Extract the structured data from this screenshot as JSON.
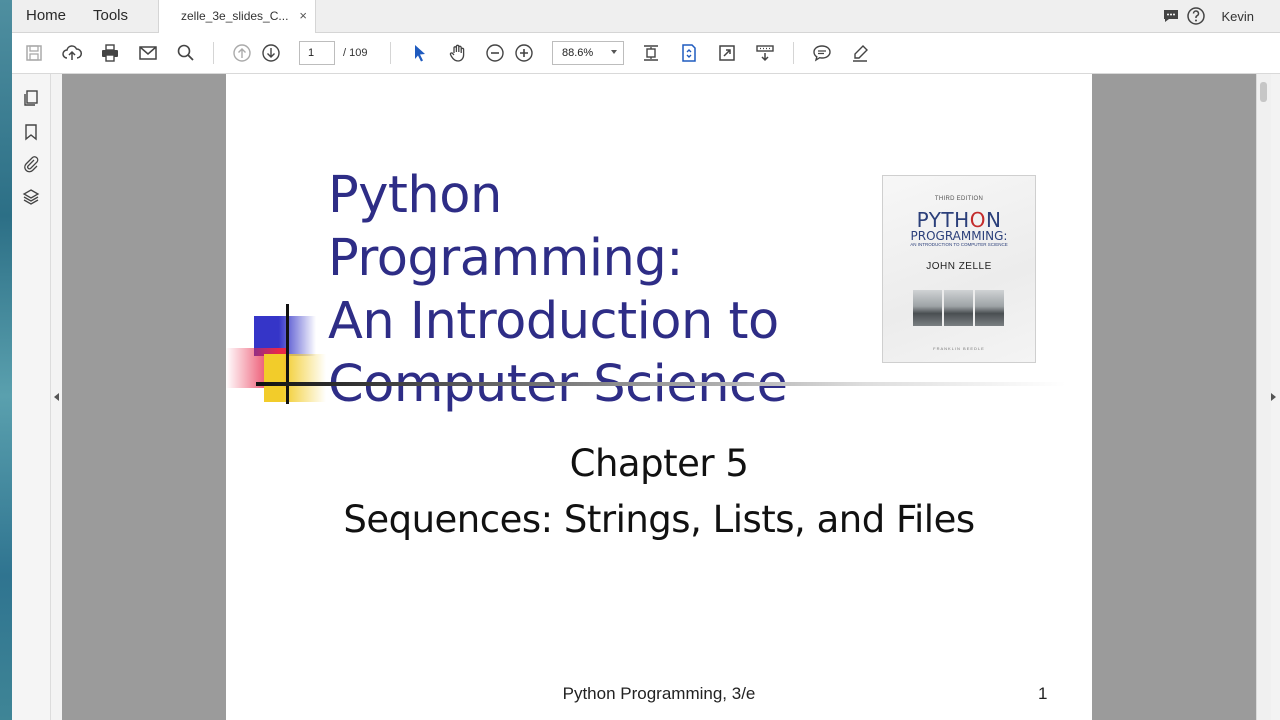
{
  "tabbar": {
    "home_label": "Home",
    "tools_label": "Tools",
    "document_tab": "zelle_3e_slides_C...",
    "close_symbol": "×",
    "user_name": "Kevin"
  },
  "toolbar": {
    "icons": [
      "save-icon",
      "upload-icon",
      "print-icon",
      "email-icon",
      "search-icon",
      "previous-page-icon",
      "next-page-icon",
      "select-arrow-icon",
      "hand-tool-icon",
      "zoom-out-icon",
      "zoom-in-icon",
      "fit-page-icon",
      "page-scroll-icon",
      "fullscreen-icon",
      "read-mode-icon",
      "comment-icon",
      "highlight-pen-icon"
    ],
    "page_current": "1",
    "page_total": "/ 109",
    "zoom": "88.6%"
  },
  "sidebar": {
    "icons": [
      "pages-icon",
      "bookmark-icon",
      "attachment-icon",
      "layers-icon"
    ]
  },
  "slide": {
    "title_lines": [
      "Python Programming:",
      "An Introduction to",
      "Computer Science"
    ],
    "cover": {
      "edition": "THIRD EDITION",
      "title_start": "PYTH",
      "title_accent": "O",
      "title_end": "N",
      "subtitle_word": "PROGRAMMING:",
      "subtitle_small": "AN INTRODUCTION TO COMPUTER SCIENCE",
      "author": "JOHN ZELLE",
      "publisher": "FRANKLIN BEEDLE"
    },
    "chapter": "Chapter 5",
    "subtitle": "Sequences: Strings, Lists, and Files",
    "footer_text": "Python Programming, 3/e",
    "page_number": "1"
  },
  "colors": {
    "title": "#2e2d86",
    "deco_blue": "#3535c8",
    "deco_red": "#e8284a",
    "deco_yellow": "#f2cc2a",
    "viewer_background": "#9b9b9b"
  }
}
